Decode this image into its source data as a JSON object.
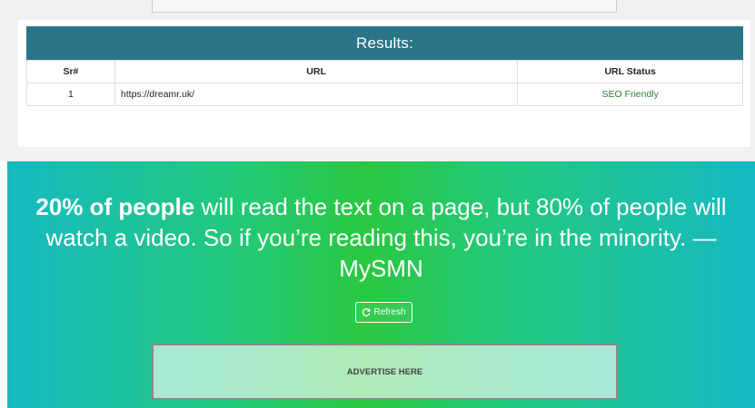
{
  "results": {
    "title": "Results:",
    "columns": [
      "Sr#",
      "URL",
      "URL Status"
    ],
    "rows": [
      {
        "sr": "1",
        "url": "https://dreamr.uk/",
        "status": "SEO Friendly"
      }
    ]
  },
  "hero": {
    "quote_bold": "20% of people",
    "quote_rest": " will read the text on a page, but 80% of people will watch a video. So if you’re reading this, you’re in the minority. — MySMN",
    "refresh_label": "Refresh",
    "refresh_icon": "refresh-icon",
    "ad_text": "ADVERTISE HERE"
  },
  "colors": {
    "header": "#2a7587",
    "status_ok": "#2e7d32",
    "hero_green": "#2ac840",
    "hero_teal": "#16b9c3"
  }
}
